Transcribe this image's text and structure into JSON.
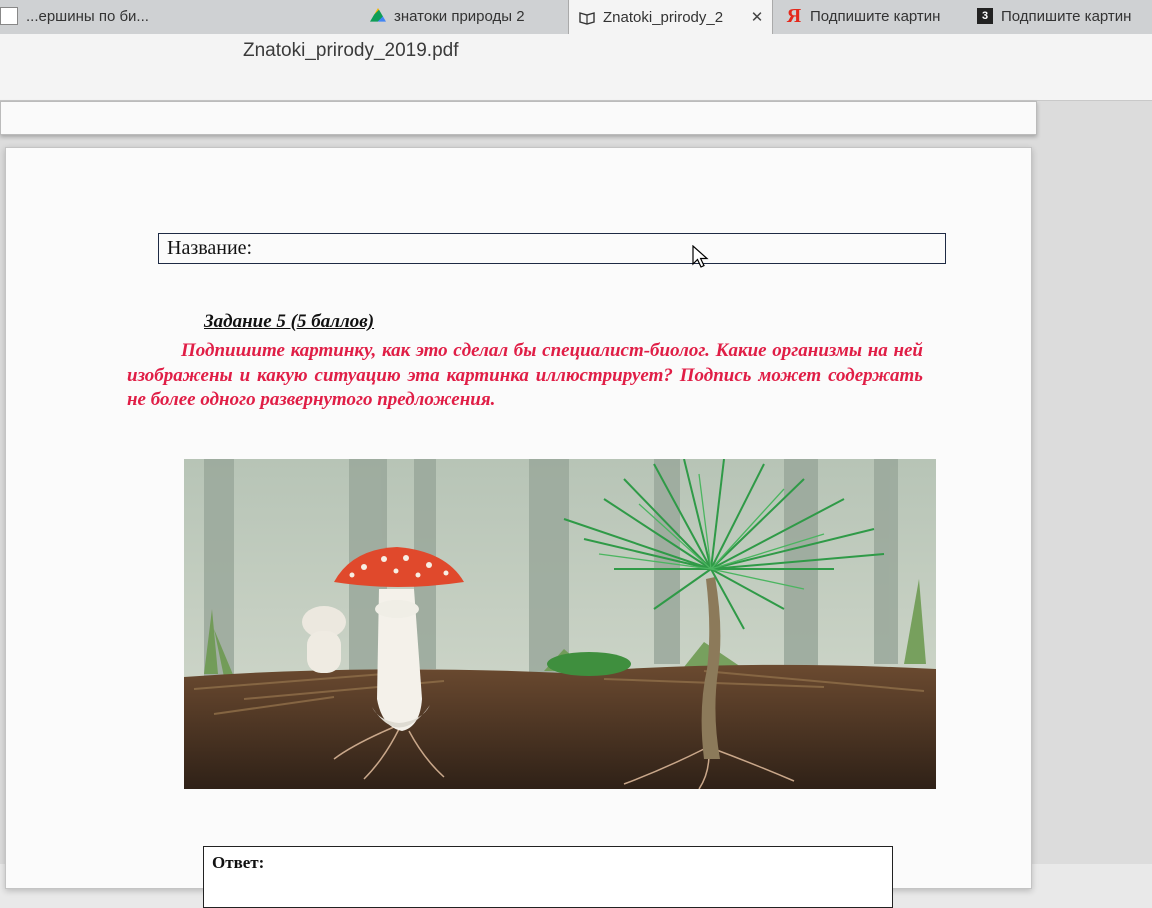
{
  "browser": {
    "tabs": [
      {
        "title": "...ершины по би...",
        "icon": "document-icon",
        "active": false
      },
      {
        "title": "знатоки природы 2",
        "icon": "google-drive-icon",
        "active": false
      },
      {
        "title": "Znatoki_prirody_2",
        "icon": "book-icon",
        "active": true,
        "close": "✕"
      },
      {
        "title": "Подпишите картин",
        "icon": "yandex-icon",
        "icon_text": "Я",
        "active": false
      },
      {
        "title": "Подпишите картин",
        "icon": "znanija-icon",
        "icon_text": "3",
        "active": false
      }
    ]
  },
  "document": {
    "filename": "Znatoki_prirody_2019.pdf"
  },
  "page": {
    "name_label": "Название:",
    "task_heading": "Задание 5  (5 баллов)",
    "instruction": "Подпишите картинку, как это сделал бы специалист-биолог. Какие организмы на ней изображены и какую ситуацию эта картинка иллюстрирует?                Подпись может содержать не более одного развернутого предложения.",
    "answer_label": "Ответ:"
  },
  "colors": {
    "instruction_text": "#e01e46",
    "mushroom_cap": "#e0492c",
    "pine_needles": "#2f9a47"
  }
}
